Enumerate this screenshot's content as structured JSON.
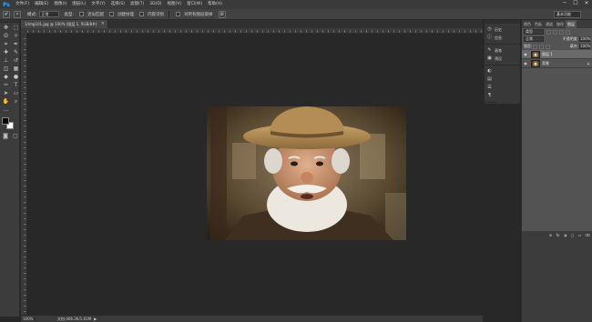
{
  "app": {
    "logo": "Ps"
  },
  "menu": [
    "文件(F)",
    "编辑(E)",
    "图像(I)",
    "图层(L)",
    "文字(Y)",
    "选择(S)",
    "滤镜(T)",
    "3D(D)",
    "视图(V)",
    "窗口(W)",
    "帮助(H)"
  ],
  "window_controls": {
    "minimize": "─",
    "maximize": "☐",
    "close": "✕"
  },
  "options": {
    "mode_label": "模式:",
    "mode_value": "正常",
    "type_label": "类型:",
    "check1_label": "近似匹配",
    "check2_label": "创建纹理",
    "check3_label": "内容识别",
    "check4_label": "对所有图层取样",
    "workspace": "基本功能"
  },
  "document": {
    "tab_title": "1/img101.jpg @ 100% (图层 1, RGB/8#)",
    "close": "×"
  },
  "status": {
    "zoom": "100%",
    "doc_size": "文档:406.2K/1.61M"
  },
  "dock": {
    "group1": [
      {
        "icon": "clock-icon",
        "glyph": "◷",
        "label": "历史"
      },
      {
        "icon": "info-icon",
        "glyph": "ⓘ",
        "label": "信息"
      }
    ],
    "group2": [
      {
        "icon": "brush-icon",
        "glyph": "✎",
        "label": "画笔"
      },
      {
        "icon": "brush-preset-icon",
        "glyph": "▣",
        "label": "预设"
      }
    ],
    "strip": [
      "◐",
      "▤",
      "☰",
      "¶"
    ]
  },
  "layers": {
    "tabs": [
      "颜色",
      "色板",
      "通道",
      "路径",
      "图层"
    ],
    "active_tab": "图层",
    "kind_select": "类型",
    "blend_mode": "正常",
    "opacity_label": "不透明度:",
    "opacity_value": "100%",
    "lock_label": "锁定:",
    "fill_label": "填充:",
    "fill_value": "100%",
    "rows": [
      {
        "name": "图层 1",
        "selected": true,
        "locked": false
      },
      {
        "name": "背景",
        "selected": false,
        "locked": true
      }
    ],
    "bottom_icons": [
      "⊕",
      "fx",
      "◑",
      "▢",
      "▭",
      "⌫"
    ]
  }
}
